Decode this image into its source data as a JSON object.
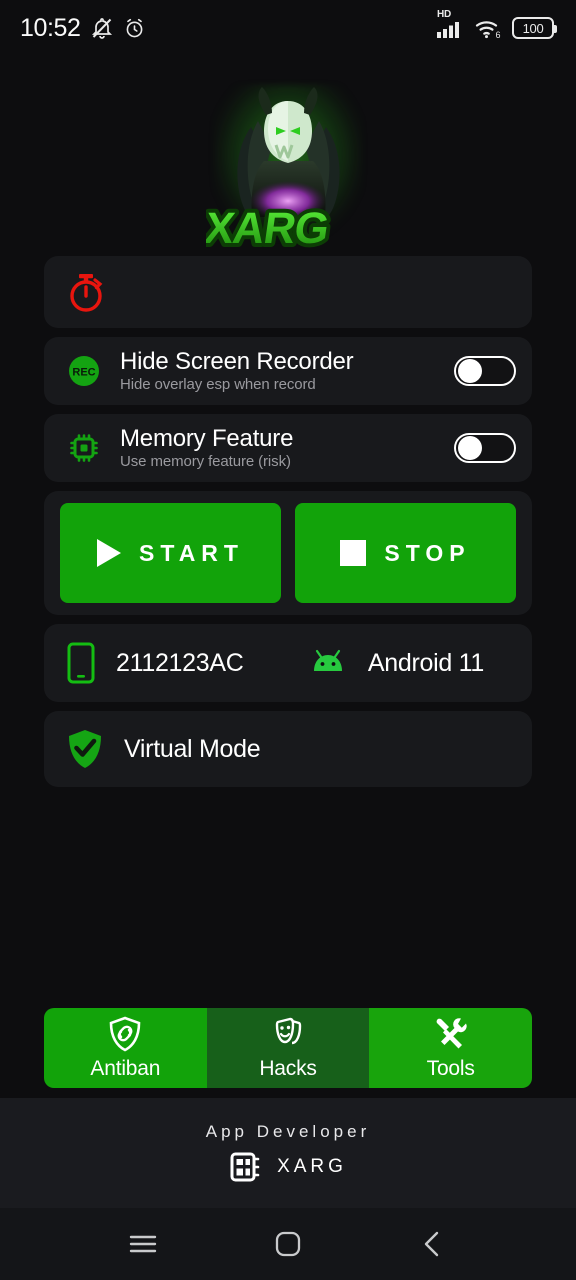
{
  "statusbar": {
    "time": "10:52",
    "icons_left": [
      "bell-off-icon",
      "alarm-icon"
    ],
    "network_label": "HD",
    "wifi_gen": "6",
    "battery_level": "100"
  },
  "logo": {
    "brand": "XARG",
    "glow_color": "#35d41f"
  },
  "timer_card": {
    "icon": "stopwatch-icon",
    "icon_color": "#e8150e",
    "value": ""
  },
  "toggles": [
    {
      "icon": "rec-icon",
      "icon_color": "#14a312",
      "title": "Hide Screen Recorder",
      "subtitle": "Hide overlay esp when record",
      "state": "off"
    },
    {
      "icon": "memory-chip-icon",
      "icon_color": "#14a312",
      "title": "Memory Feature",
      "subtitle": "Use memory feature (risk)",
      "state": "off"
    }
  ],
  "actions": {
    "start_label": "START",
    "stop_label": "STOP",
    "button_color": "#12a30a"
  },
  "device": {
    "phone_icon": "smartphone-icon",
    "model": "2112123AC",
    "android_icon": "android-icon",
    "os": "Android 11"
  },
  "virtual_mode": {
    "icon": "shield-check-icon",
    "label": "Virtual Mode"
  },
  "tabs": [
    {
      "label": "Antiban",
      "icon": "shield-link-icon",
      "color": "#12a30a",
      "selected": false
    },
    {
      "label": "Hacks",
      "icon": "masks-icon",
      "color": "#17601a",
      "selected": false
    },
    {
      "label": "Tools",
      "icon": "tools-icon",
      "color": "#18a40c",
      "selected": true
    }
  ],
  "footer": {
    "developer_label": "App Developer",
    "developer_icon": "chip-icon",
    "developer_name": "XARG"
  },
  "navbar": {
    "recents": "menu-icon",
    "home": "home-square-icon",
    "back": "back-chevron-icon"
  }
}
